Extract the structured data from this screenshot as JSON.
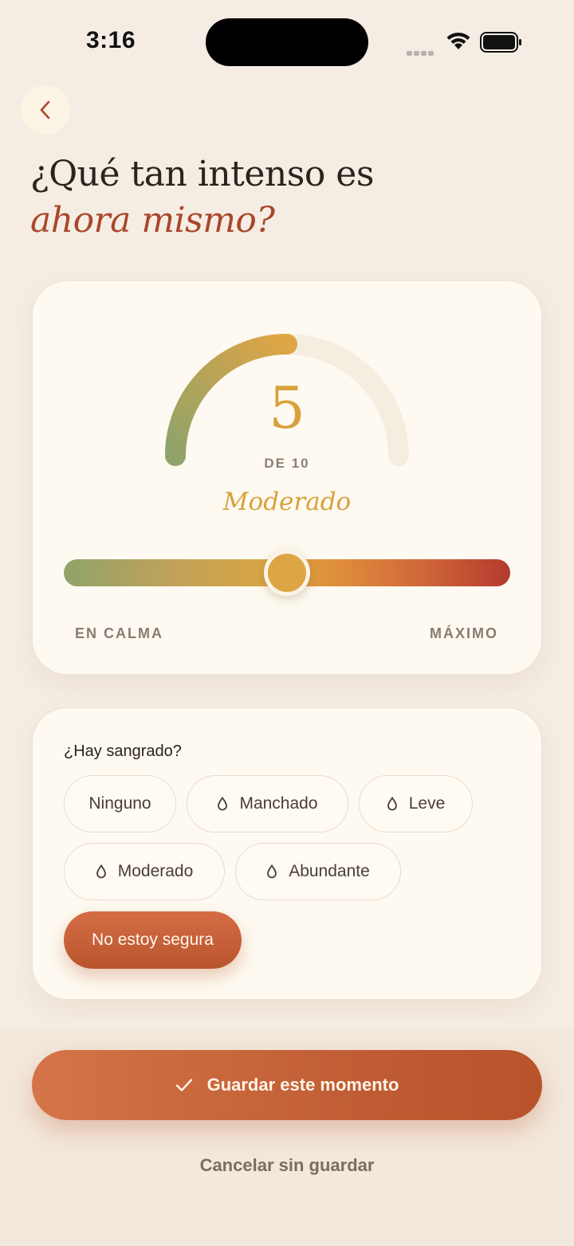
{
  "status_bar": {
    "time": "3:16"
  },
  "header": {
    "back_icon": "chevron-left-icon",
    "title_line1": "¿Qué tan intenso es",
    "title_line2": "ahora mismo?"
  },
  "intensity": {
    "value": "5",
    "max_label": "DE 10",
    "level_label": "Moderado",
    "slider_fraction": 0.5,
    "scale_min_label": "EN CALMA",
    "scale_max_label": "MÁXIMO",
    "gauge_colors": [
      "#8fa36a",
      "#dea545"
    ]
  },
  "bleeding": {
    "question": "¿Hay sangrado?",
    "options": [
      {
        "label": "Ninguno",
        "icon": "",
        "selected": false
      },
      {
        "label": "Manchado",
        "icon": "drop-icon",
        "selected": false
      },
      {
        "label": "Leve",
        "icon": "drop-icon",
        "selected": false
      },
      {
        "label": "Moderado",
        "icon": "drop-icon",
        "selected": false
      },
      {
        "label": "Abundante",
        "icon": "drop-icon",
        "selected": false
      },
      {
        "label": "No estoy segura",
        "icon": "",
        "selected": true
      }
    ]
  },
  "actions": {
    "save_icon": "check-icon",
    "save_label": "Guardar este momento",
    "cancel_label": "Cancelar sin guardar"
  },
  "colors": {
    "accent": "#c15e35",
    "background": "#f5ede3",
    "amber": "#d9a13b"
  }
}
